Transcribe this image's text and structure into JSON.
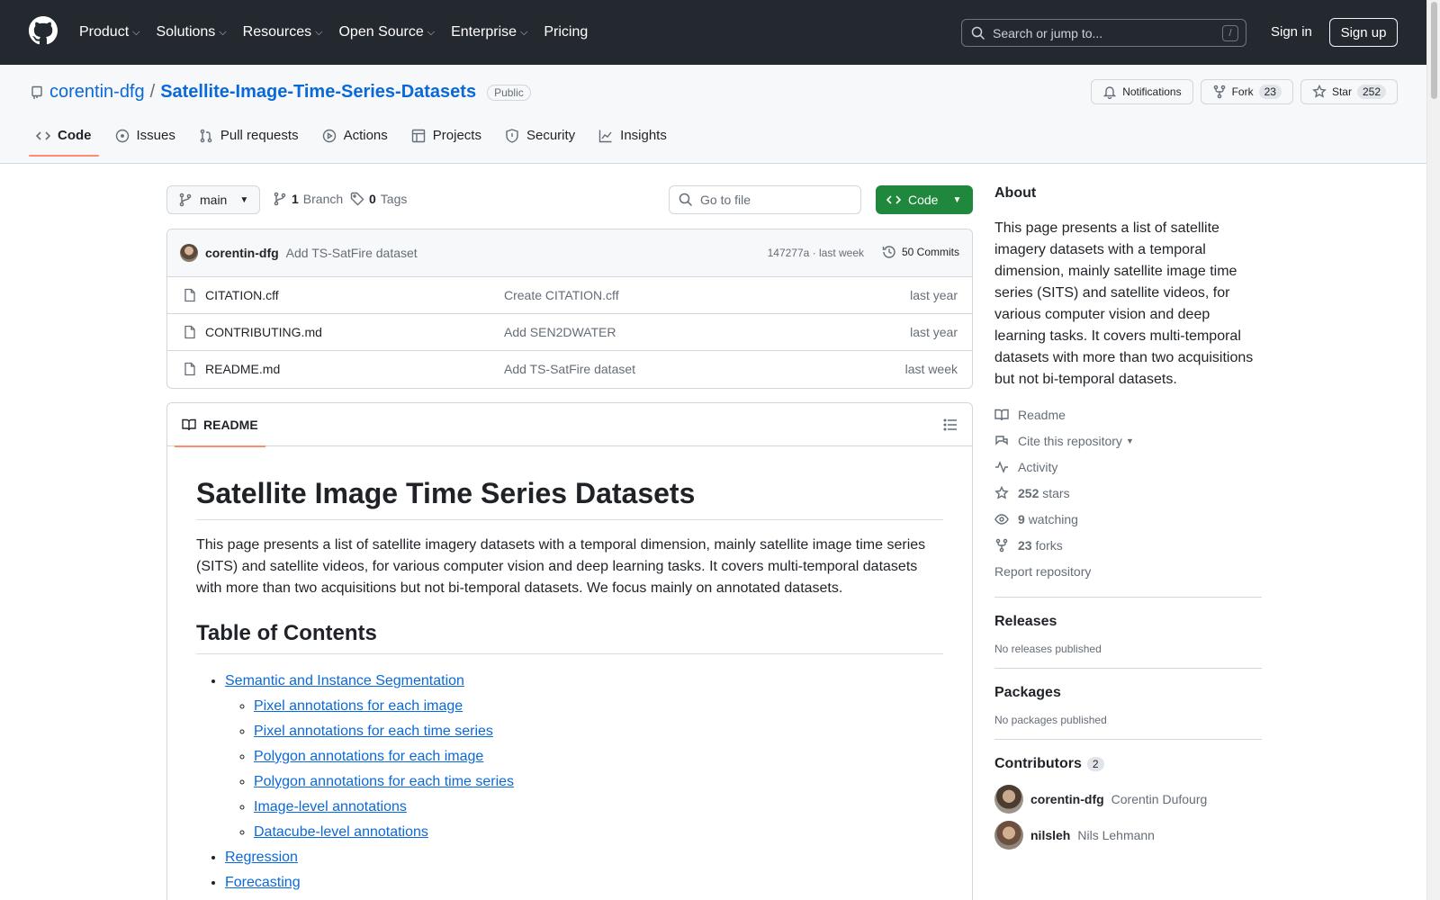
{
  "nav": {
    "items": [
      {
        "label": "Product",
        "chevron": true
      },
      {
        "label": "Solutions",
        "chevron": true
      },
      {
        "label": "Resources",
        "chevron": true
      },
      {
        "label": "Open Source",
        "chevron": true
      },
      {
        "label": "Enterprise",
        "chevron": true
      },
      {
        "label": "Pricing",
        "chevron": false
      }
    ],
    "search_placeholder": "Search or jump to...",
    "search_shortcut": "/",
    "sign_in": "Sign in",
    "sign_up": "Sign up"
  },
  "repo": {
    "owner": "corentin-dfg",
    "separator": "/",
    "name": "Satellite-Image-Time-Series-Datasets",
    "visibility": "Public",
    "notifications_label": "Notifications",
    "fork_label": "Fork",
    "fork_count": "23",
    "star_label": "Star",
    "star_count": "252"
  },
  "tabs": [
    {
      "label": "Code",
      "icon": "code-icon",
      "active": true
    },
    {
      "label": "Issues",
      "icon": "issue-icon",
      "active": false
    },
    {
      "label": "Pull requests",
      "icon": "pull-request-icon",
      "active": false
    },
    {
      "label": "Actions",
      "icon": "play-icon",
      "active": false
    },
    {
      "label": "Projects",
      "icon": "table-icon",
      "active": false
    },
    {
      "label": "Security",
      "icon": "shield-icon",
      "active": false
    },
    {
      "label": "Insights",
      "icon": "graph-icon",
      "active": false
    }
  ],
  "branchbar": {
    "branch": "main",
    "branch_count": "1",
    "branch_word": "Branch",
    "tag_count": "0",
    "tag_word": "Tags",
    "go_to_file": "Go to file",
    "code_button": "Code"
  },
  "commit": {
    "author": "corentin-dfg",
    "message": "Add TS-SatFire dataset",
    "meta": "147277a · last week",
    "commits_label": "50 Commits"
  },
  "files": [
    {
      "name": "CITATION.cff",
      "message": "Create CITATION.cff",
      "time": "last year"
    },
    {
      "name": "CONTRIBUTING.md",
      "message": "Add SEN2DWATER",
      "time": "last year"
    },
    {
      "name": "README.md",
      "message": "Add TS-SatFire dataset",
      "time": "last week"
    }
  ],
  "readme": {
    "tab_label": "README",
    "title": "Satellite Image Time Series Datasets",
    "intro": "This page presents a list of satellite imagery datasets with a temporal dimension, mainly satellite image time series (SITS) and satellite videos, for various computer vision and deep learning tasks. It covers multi-temporal datasets with more than two acquisitions but not bi-temporal datasets. We focus mainly on annotated datasets.",
    "toc_title": "Table of Contents",
    "toc": [
      {
        "label": "Semantic and Instance Segmentation",
        "children": [
          "Pixel annotations for each image",
          "Pixel annotations for each time series",
          "Polygon annotations for each image",
          "Polygon annotations for each time series",
          "Image-level annotations",
          "Datacube-level annotations"
        ]
      },
      {
        "label": "Regression",
        "children": []
      },
      {
        "label": "Forecasting",
        "children": []
      }
    ]
  },
  "about": {
    "title": "About",
    "description": "This page presents a list of satellite imagery datasets with a temporal dimension, mainly satellite image time series (SITS) and satellite videos, for various computer vision and deep learning tasks. It covers multi-temporal datasets with more than two acquisitions but not bi-temporal datasets.",
    "readme_link": "Readme",
    "cite_link": "Cite this repository",
    "activity_link": "Activity",
    "stars_count": "252",
    "stars_word": "stars",
    "watching_count": "9",
    "watching_word": "watching",
    "forks_count": "23",
    "forks_word": "forks",
    "report": "Report repository"
  },
  "releases": {
    "title": "Releases",
    "empty": "No releases published"
  },
  "packages": {
    "title": "Packages",
    "empty": "No packages published"
  },
  "contributors": {
    "title": "Contributors",
    "count": "2",
    "people": [
      {
        "login": "corentin-dfg",
        "name": "Corentin Dufourg"
      },
      {
        "login": "nilsleh",
        "name": "Nils Lehmann"
      }
    ]
  },
  "colors": {
    "header_bg": "#24292f",
    "link": "#0969da",
    "primary_button": "#1f883d",
    "active_tab_underline": "#fd8c73"
  }
}
